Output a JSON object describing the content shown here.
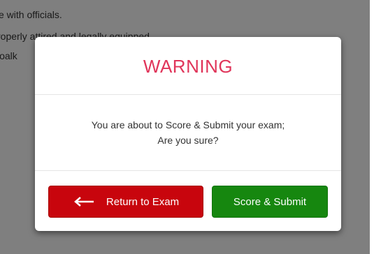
{
  "background_page": {
    "lines": [
      "e with officials.",
      "roperly attired and legally equipped.",
      "joalk"
    ]
  },
  "modal": {
    "title": "WARNING",
    "message_line1": "You are about to Score & Submit your exam;",
    "message_line2": "Are you sure?",
    "return_button_label": "Return to Exam",
    "submit_button_label": "Score & Submit"
  },
  "colors": {
    "title": "#e0355a",
    "return_button": "#c8050d",
    "submit_button": "#16870f"
  },
  "icons": {
    "return_button_icon": "arrow-left-icon"
  }
}
